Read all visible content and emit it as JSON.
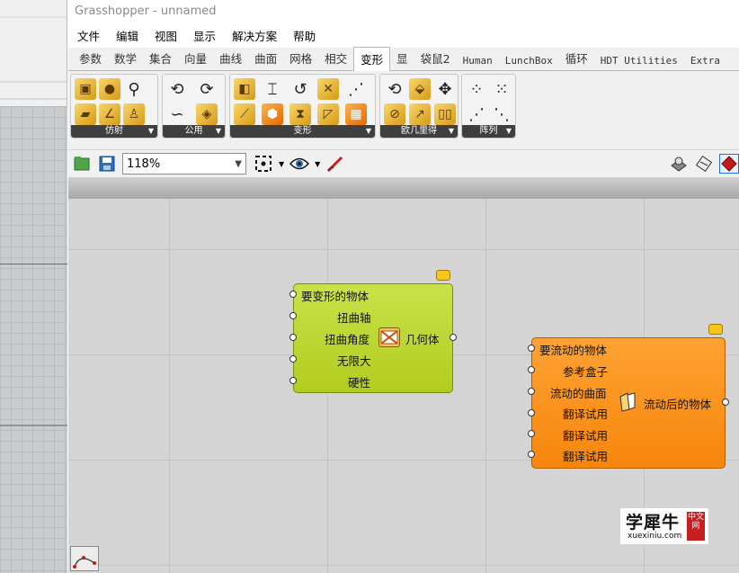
{
  "window": {
    "title": "Grasshopper - unnamed"
  },
  "menu": [
    "文件",
    "编辑",
    "视图",
    "显示",
    "解决方案",
    "帮助"
  ],
  "tabs": [
    {
      "label": "参数"
    },
    {
      "label": "数学"
    },
    {
      "label": "集合"
    },
    {
      "label": "向量"
    },
    {
      "label": "曲线"
    },
    {
      "label": "曲面"
    },
    {
      "label": "网格"
    },
    {
      "label": "相交"
    },
    {
      "label": "变形",
      "active": true
    },
    {
      "label": "显"
    },
    {
      "label": "袋鼠2"
    },
    {
      "label": "Human"
    },
    {
      "label": "LunchBox"
    },
    {
      "label": "循环"
    },
    {
      "label": "HDT Utilities"
    },
    {
      "label": "Extra"
    }
  ],
  "ribbon_groups": [
    {
      "label": "仿射"
    },
    {
      "label": "公用"
    },
    {
      "label": "变形"
    },
    {
      "label": "欧几里得"
    },
    {
      "label": "阵列"
    }
  ],
  "toolbar": {
    "zoom": "118%"
  },
  "components": {
    "twist": {
      "inputs": [
        "要变形的物体",
        "扭曲轴",
        "扭曲角度",
        "无限大",
        "硬性"
      ],
      "output": "几何体",
      "color": "#bcd52f"
    },
    "flow": {
      "inputs": [
        "要流动的物体",
        "参考盒子",
        "流动的曲面",
        "翻译试用",
        "翻译试用",
        "翻译试用"
      ],
      "output": "流动后的物体",
      "color": "#f8901c"
    }
  },
  "watermark": {
    "name": "学犀牛",
    "site": "xuexiniu.com",
    "seal": "中文网"
  }
}
